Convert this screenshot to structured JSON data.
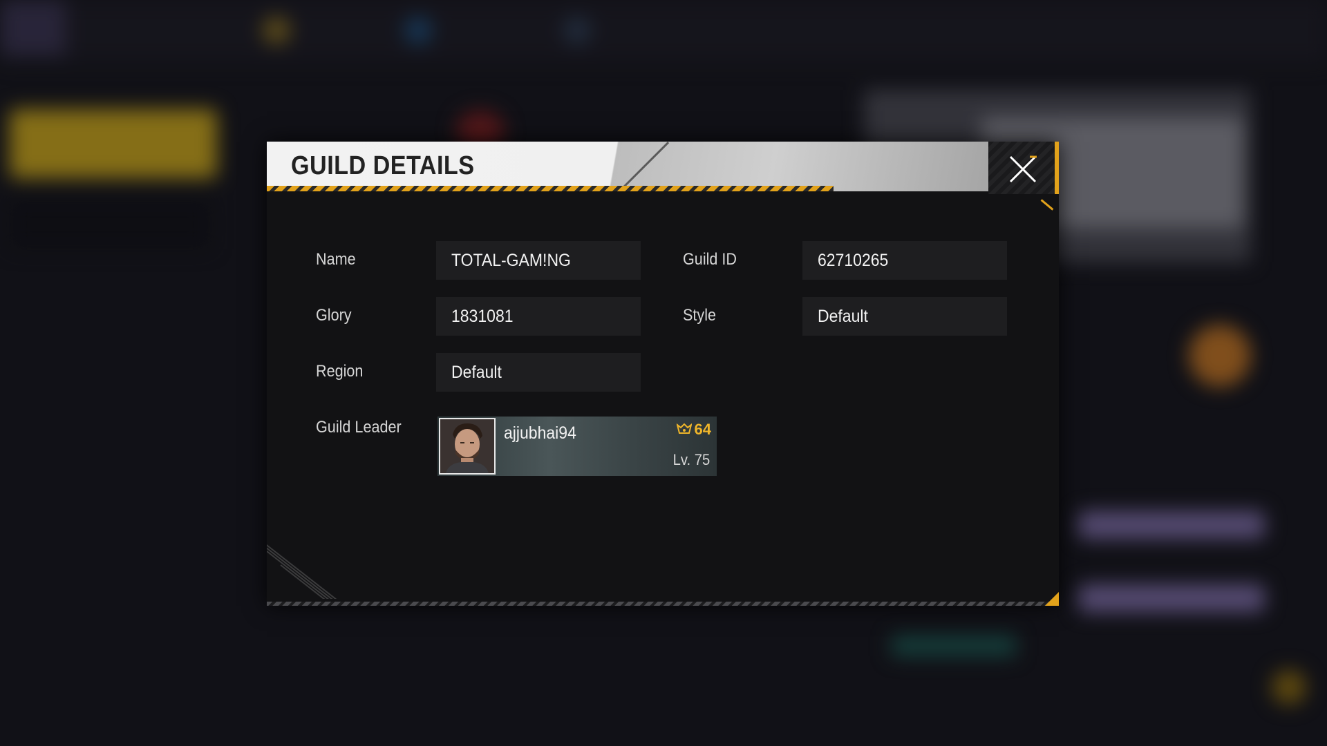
{
  "modal": {
    "title": "GUILD DETAILS"
  },
  "fields": {
    "name_label": "Name",
    "name_value": "TOTAL-GAM!NG",
    "guild_id_label": "Guild ID",
    "guild_id_value": "62710265",
    "glory_label": "Glory",
    "glory_value": "1831081",
    "style_label": "Style",
    "style_value": "Default",
    "region_label": "Region",
    "region_value": "Default",
    "leader_label": "Guild Leader"
  },
  "leader": {
    "name": "ajjubhai94",
    "badge_value": "64",
    "level": "Lv. 75"
  },
  "colors": {
    "accent": "#e2a21b",
    "panel": "#121214",
    "field": "#1e1e20"
  },
  "icons": {
    "close": "close-icon",
    "badge": "guild-badge-icon",
    "avatar": "player-avatar"
  }
}
